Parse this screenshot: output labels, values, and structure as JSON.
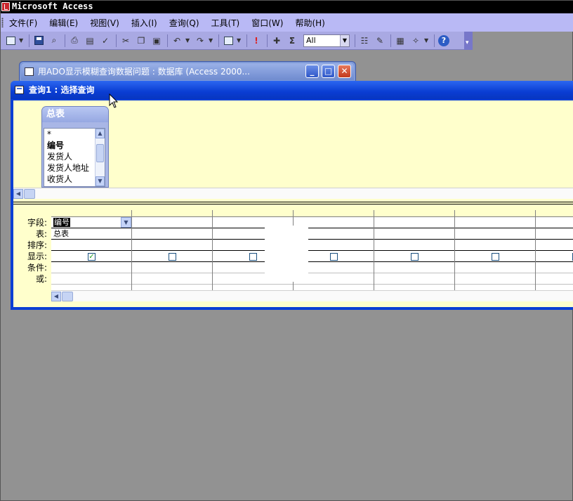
{
  "app": {
    "title": "Microsoft Access"
  },
  "menu": {
    "items": [
      "文件(F)",
      "编辑(E)",
      "视图(V)",
      "插入(I)",
      "查询(Q)",
      "工具(T)",
      "窗口(W)",
      "帮助(H)"
    ]
  },
  "toolbar": {
    "top_values_selected": "All",
    "icons": [
      "view-icon",
      "save-icon",
      "search-icon",
      "print-icon",
      "print-preview-icon",
      "spelling-icon",
      "cut-icon",
      "copy-icon",
      "paste-icon",
      "undo-icon",
      "redo-icon",
      "query-type-icon",
      "run-icon",
      "show-table-icon",
      "totals-icon",
      "properties-icon",
      "builder-icon",
      "database-window-icon",
      "new-object-icon",
      "help-icon"
    ]
  },
  "db_window": {
    "title": "用ADO显示模糊查询数据问题 : 数据库 (Access 2000..."
  },
  "query_window": {
    "title": "查询1 : 选择查询"
  },
  "table_box": {
    "title": "总表",
    "fields": [
      {
        "name": "*",
        "key": false
      },
      {
        "name": "编号",
        "key": true
      },
      {
        "name": "发货人",
        "key": false
      },
      {
        "name": "发货人地址",
        "key": false
      },
      {
        "name": "收货人",
        "key": false
      }
    ]
  },
  "grid": {
    "row_labels": [
      "字段:",
      "表:",
      "排序:",
      "显示:",
      "条件:",
      "或:"
    ],
    "columns": [
      {
        "field": "编号",
        "table": "总表",
        "show": true
      },
      {
        "field": "",
        "table": "",
        "show": false
      },
      {
        "field": "",
        "table": "",
        "show": false
      },
      {
        "field": "",
        "table": "",
        "show": false
      },
      {
        "field": "",
        "table": "",
        "show": false
      },
      {
        "field": "",
        "table": "",
        "show": false
      },
      {
        "field": "",
        "table": "",
        "show": false
      }
    ]
  },
  "colors": {
    "desktop": "#929292",
    "menubar": "#b9b9f5",
    "toolbar": "#a9a9e3",
    "query_titlebar": "#0a3dd3",
    "design_background": "#ffffcc",
    "check_mark": "#21a121"
  }
}
